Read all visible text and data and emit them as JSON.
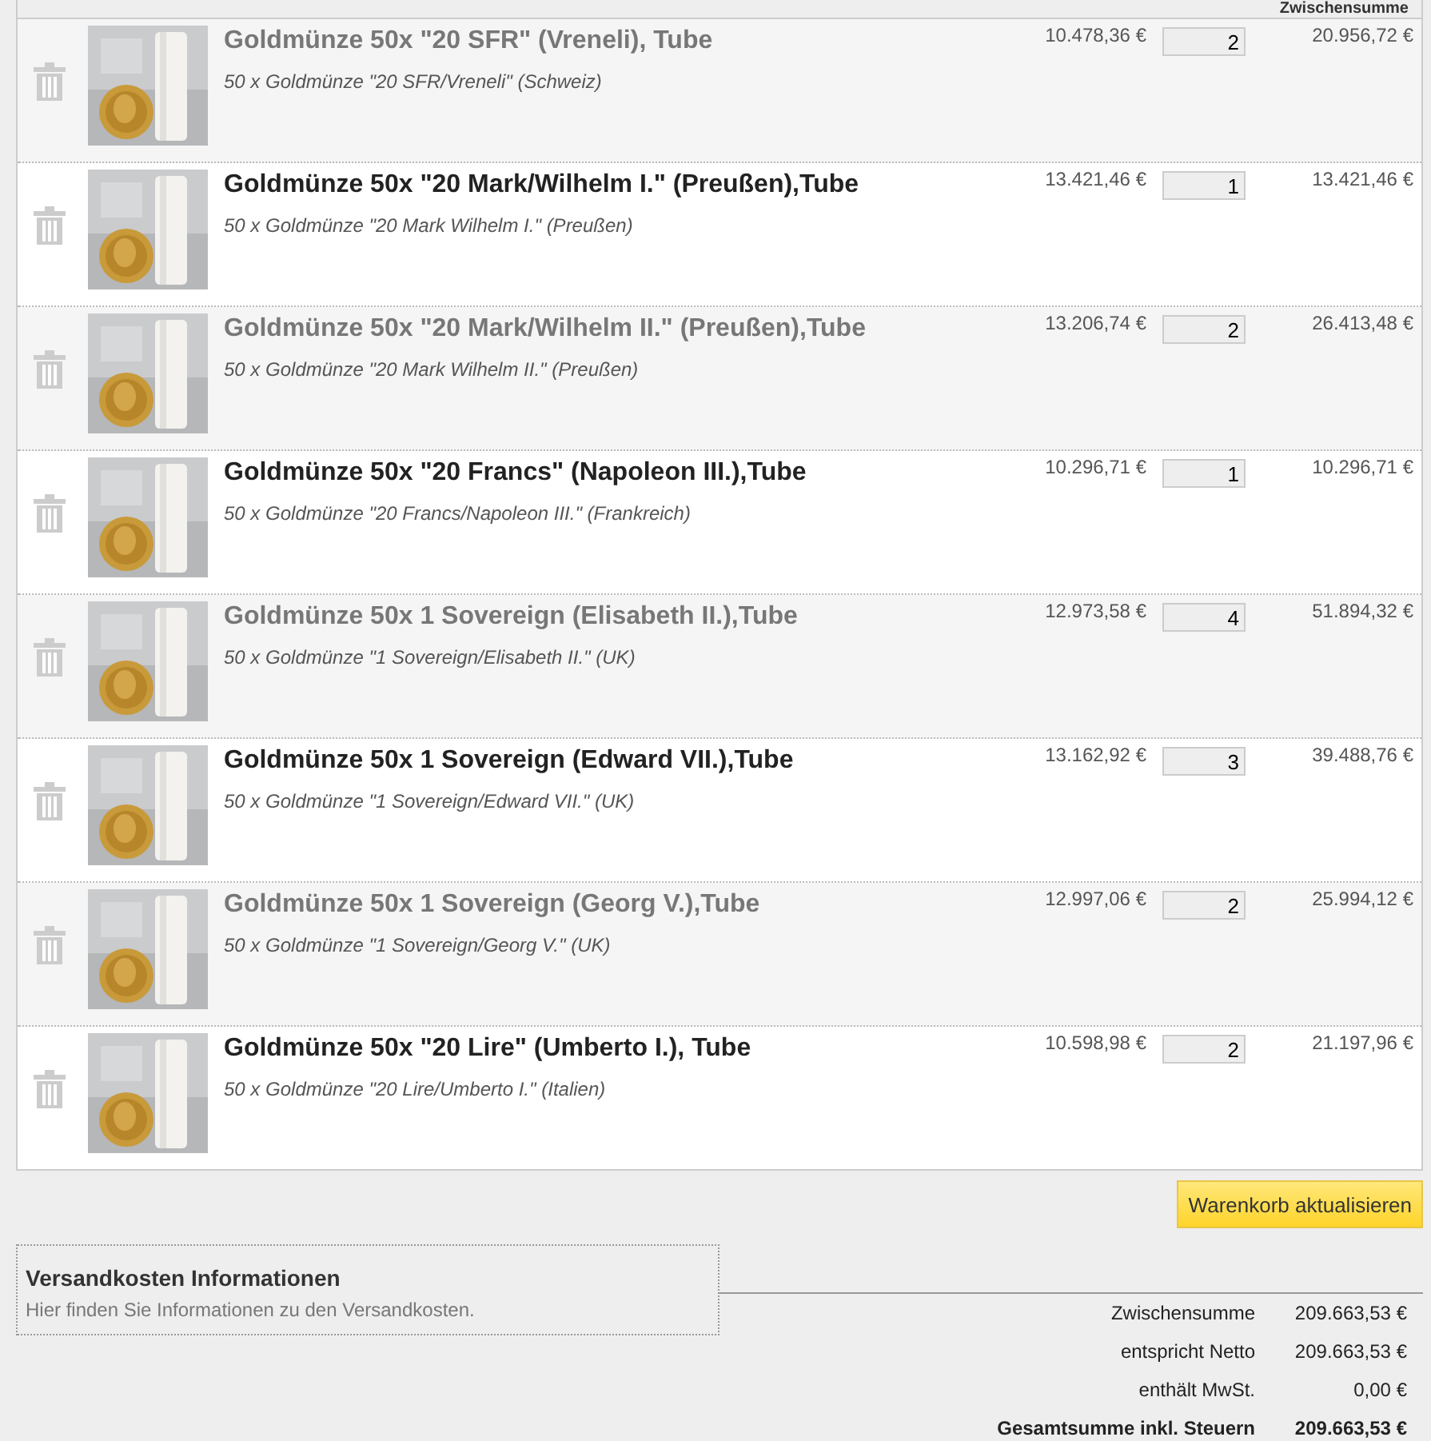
{
  "table": {
    "columns": [
      "Zwischensumme"
    ],
    "rows": [
      {
        "title": "Goldmünze 50x \"20 SFR\" (Vreneli), Tube",
        "description": "50 x Goldmünze \"20 SFR/Vreneli\" (Schweiz)",
        "price": "10.478,36 €",
        "quantity": "2",
        "total": "20.956,72 €"
      },
      {
        "title": "Goldmünze 50x \"20 Mark/Wilhelm I.\" (Preußen),Tube",
        "description": "50 x Goldmünze \"20 Mark Wilhelm I.\" (Preußen)",
        "price": "13.421,46 €",
        "quantity": "1",
        "total": "13.421,46 €"
      },
      {
        "title": "Goldmünze 50x \"20 Mark/Wilhelm II.\" (Preußen),Tube",
        "description": "50 x Goldmünze \"20 Mark Wilhelm II.\" (Preußen)",
        "price": "13.206,74 €",
        "quantity": "2",
        "total": "26.413,48 €"
      },
      {
        "title": "Goldmünze 50x \"20 Francs\" (Napoleon III.),Tube",
        "description": "50 x Goldmünze \"20 Francs/Napoleon III.\" (Frankreich)",
        "price": "10.296,71 €",
        "quantity": "1",
        "total": "10.296,71 €"
      },
      {
        "title": "Goldmünze 50x 1 Sovereign (Elisabeth II.),Tube",
        "description": "50 x Goldmünze \"1 Sovereign/Elisabeth II.\" (UK)",
        "price": "12.973,58 €",
        "quantity": "4",
        "total": "51.894,32 €"
      },
      {
        "title": "Goldmünze 50x 1 Sovereign (Edward VII.),Tube",
        "description": "50 x Goldmünze \"1 Sovereign/Edward VII.\" (UK)",
        "price": "13.162,92 €",
        "quantity": "3",
        "total": "39.488,76 €"
      },
      {
        "title": "Goldmünze 50x 1 Sovereign (Georg V.),Tube",
        "description": "50 x Goldmünze \"1 Sovereign/Georg V.\" (UK)",
        "price": "12.997,06 €",
        "quantity": "2",
        "total": "25.994,12 €"
      },
      {
        "title": "Goldmünze 50x \"20 Lire\" (Umberto I.), Tube",
        "description": "50 x Goldmünze \"20 Lire/Umberto I.\" (Italien)",
        "price": "10.598,98 €",
        "quantity": "2",
        "total": "21.197,96 €"
      }
    ]
  },
  "update_button": "Warenkorb aktualisieren",
  "shipping_info": {
    "title": "Versandkosten Informationen",
    "text": "Hier finden Sie Informationen zu den Versandkosten."
  },
  "totals": [
    {
      "label": "Zwischensumme",
      "value": "209.663,53 €",
      "bold": false
    },
    {
      "label": "entspricht Netto",
      "value": "209.663,53 €",
      "bold": false
    },
    {
      "label": "enthält MwSt.",
      "value": "0,00 €",
      "bold": false
    },
    {
      "label": "Gesamtsumme inkl. Steuern",
      "value": "209.663,53 €",
      "bold": true
    }
  ]
}
